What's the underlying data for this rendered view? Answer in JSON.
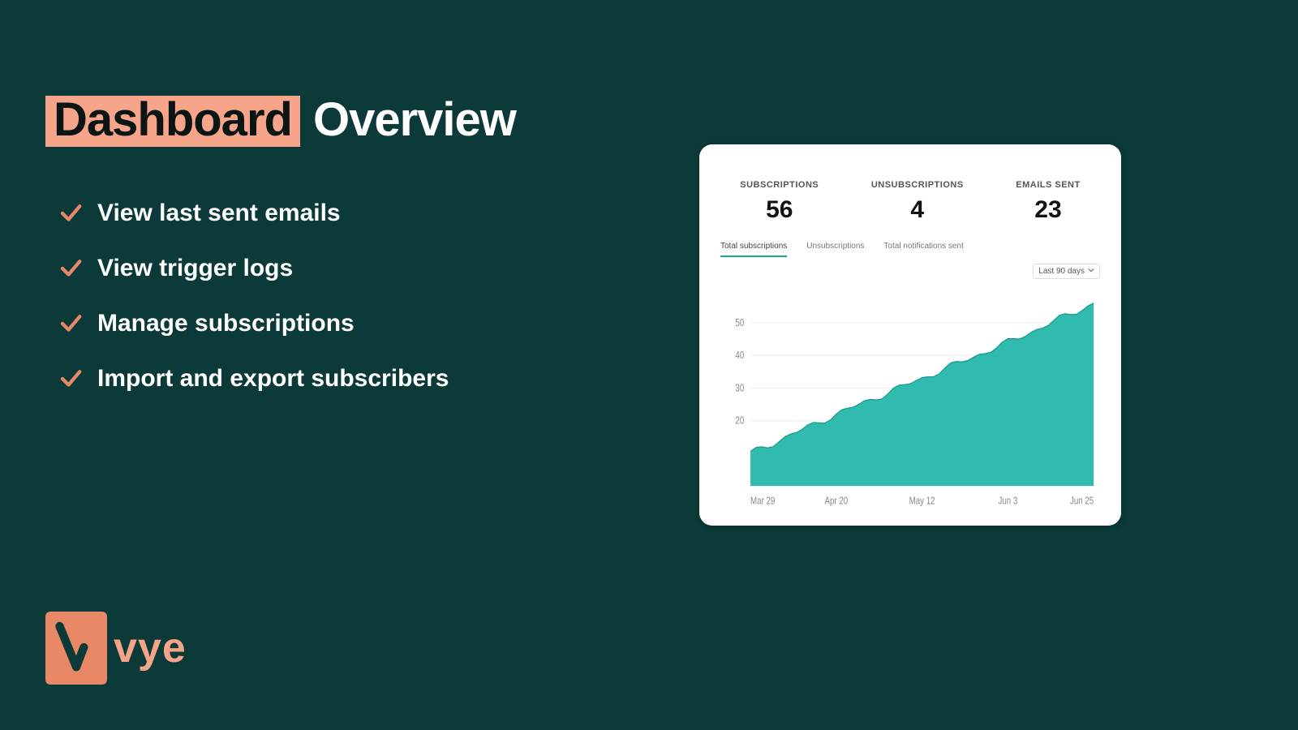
{
  "title": {
    "highlight": "Dashboard",
    "rest": "Overview"
  },
  "bullets": [
    "View last sent emails",
    "View trigger logs",
    "Manage subscriptions",
    "Import and export subscribers"
  ],
  "logo": {
    "text": "vye"
  },
  "card": {
    "metrics": [
      {
        "label": "SUBSCRIPTIONS",
        "value": "56"
      },
      {
        "label": "UNSUBSCRIPTIONS",
        "value": "4"
      },
      {
        "label": "EMAILS SENT",
        "value": "23"
      }
    ],
    "tabs": [
      {
        "label": "Total subscriptions",
        "active": true
      },
      {
        "label": "Unsubscriptions",
        "active": false
      },
      {
        "label": "Total notifications sent",
        "active": false
      }
    ],
    "range": "Last 90 days"
  },
  "chart_data": {
    "type": "area",
    "title": "",
    "xlabel": "",
    "ylabel": "",
    "ylim": [
      0,
      60
    ],
    "y_ticks": [
      20,
      30,
      40,
      50
    ],
    "x_ticks": [
      "Mar 29",
      "Apr 20",
      "May 12",
      "Jun 3",
      "Jun 25"
    ],
    "series": [
      {
        "name": "Total subscriptions",
        "x": [
          "Mar 29",
          "Apr 20",
          "May 12",
          "Jun 3",
          "Jun 25"
        ],
        "values": [
          10,
          22,
          33,
          44,
          56
        ]
      }
    ]
  },
  "colors": {
    "accent": "#f6a48a",
    "chart_fill": "#1fb5a7",
    "background": "#0b3a38"
  }
}
